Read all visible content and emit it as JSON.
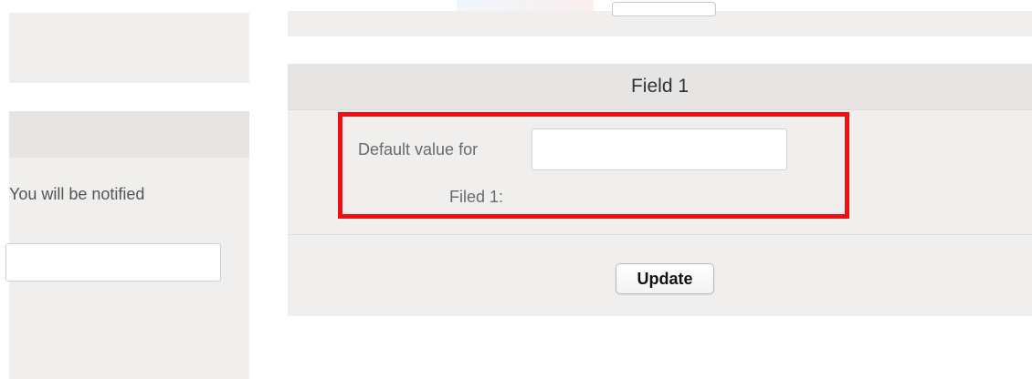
{
  "left_column": {
    "notice_text": "You will be notified",
    "input_value": ""
  },
  "field_section": {
    "header": "Field 1",
    "default_label_line1": "Default value for",
    "default_label_line2": "Filed 1:",
    "default_value": "",
    "update_label": "Update"
  },
  "colors": {
    "panel_bg": "#f0efed",
    "header_bg": "#e6e5e3",
    "highlight": "#ee1111"
  }
}
